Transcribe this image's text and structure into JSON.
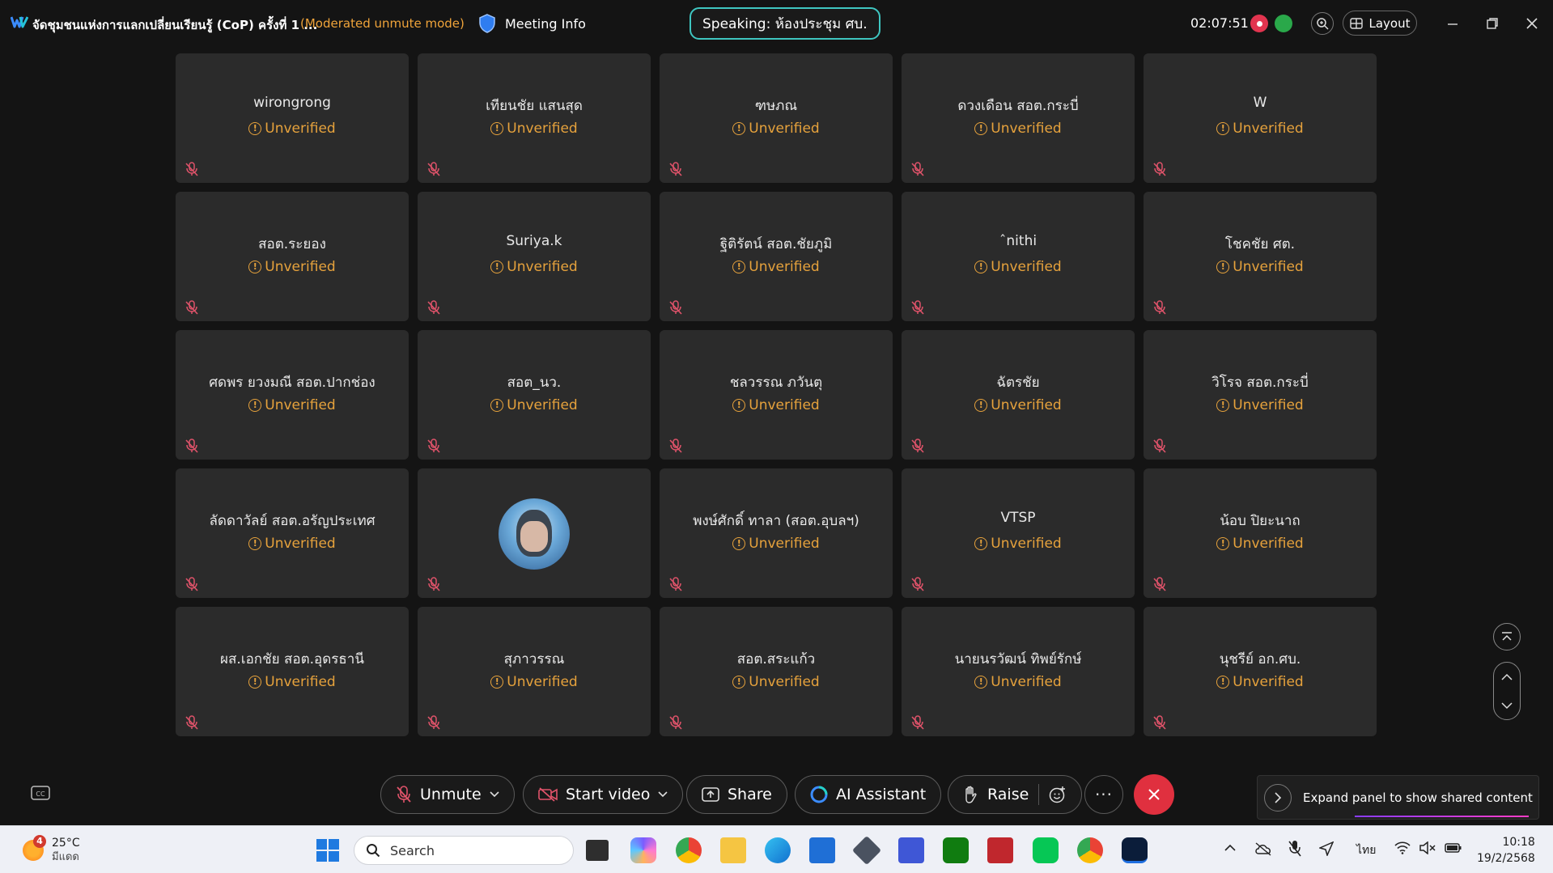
{
  "window": {
    "title": "จัดชุมชนแห่งการแลกเปลี่ยนเรียนรู้ (CoP) ครั้งที่ 1 ...",
    "mode": "(Moderated unmute mode)",
    "meeting_info_label": "Meeting Info",
    "speaking": "Speaking: ห้องประชุม ศบ.",
    "timer": "02:07:51",
    "layout_label": "Layout"
  },
  "participants": [
    {
      "name": "wirongrong",
      "status": "Unverified"
    },
    {
      "name": "เทียนชัย แสนสุด",
      "status": "Unverified"
    },
    {
      "name": "ฑษภณ",
      "status": "Unverified"
    },
    {
      "name": "ดวงเดือน สอต.กระบี่",
      "status": "Unverified"
    },
    {
      "name": "W",
      "status": "Unverified"
    },
    {
      "name": "สอต.ระยอง",
      "status": "Unverified"
    },
    {
      "name": "Suriya.k",
      "status": "Unverified"
    },
    {
      "name": "ฐิติรัตน์ สอต.ชัยภูมิ",
      "status": "Unverified"
    },
    {
      "name": "ˆnithi",
      "status": "Unverified"
    },
    {
      "name": "โชคชัย ศต.",
      "status": "Unverified"
    },
    {
      "name": "ศดพร ยวงมณี สอต.ปากช่อง",
      "status": "Unverified"
    },
    {
      "name": "สอต_นว.",
      "status": "Unverified"
    },
    {
      "name": "ชลวรรณ ภวันตุ",
      "status": "Unverified"
    },
    {
      "name": "ฉัตรชัย",
      "status": "Unverified"
    },
    {
      "name": "วิโรจ สอต.กระบี่",
      "status": "Unverified"
    },
    {
      "name": "ลัดดาวัลย์ สอต.อรัญประเทศ",
      "status": "Unverified"
    },
    {
      "name": "",
      "status": "",
      "avatar": true
    },
    {
      "name": "พงษ์ศักดิ์ ทาลา (สอต.อุบลฯ)",
      "status": "Unverified"
    },
    {
      "name": "VTSP",
      "status": "Unverified"
    },
    {
      "name": "น้อบ ปิยะนาถ",
      "status": "Unverified"
    },
    {
      "name": "ผส.เอกชัย สอต.อุดรธานี",
      "status": "Unverified"
    },
    {
      "name": "สุภาวรรณ",
      "status": "Unverified"
    },
    {
      "name": "สอต.สระแก้ว",
      "status": "Unverified"
    },
    {
      "name": "นายนรวัฒน์ ทิพย์รักษ์",
      "status": "Unverified"
    },
    {
      "name": "นุชรีย์ อก.ศบ.",
      "status": "Unverified"
    }
  ],
  "toolbar": {
    "unmute": "Unmute",
    "start_video": "Start video",
    "share": "Share",
    "ai_assistant": "AI Assistant",
    "raise": "Raise",
    "more": "···",
    "expand_panel": "Expand panel to show shared content"
  },
  "taskbar": {
    "weather_temp": "25°C",
    "weather_desc": "มีแดด",
    "weather_badge": "4",
    "search_placeholder": "Search",
    "language": "ไทย",
    "time": "10:18",
    "date": "19/2/2568"
  },
  "colors": {
    "unverified": "#e6a23c",
    "speaking_border": "#3fc6c1",
    "end_call": "#e0303f",
    "mute_icon": "#e0536a"
  }
}
